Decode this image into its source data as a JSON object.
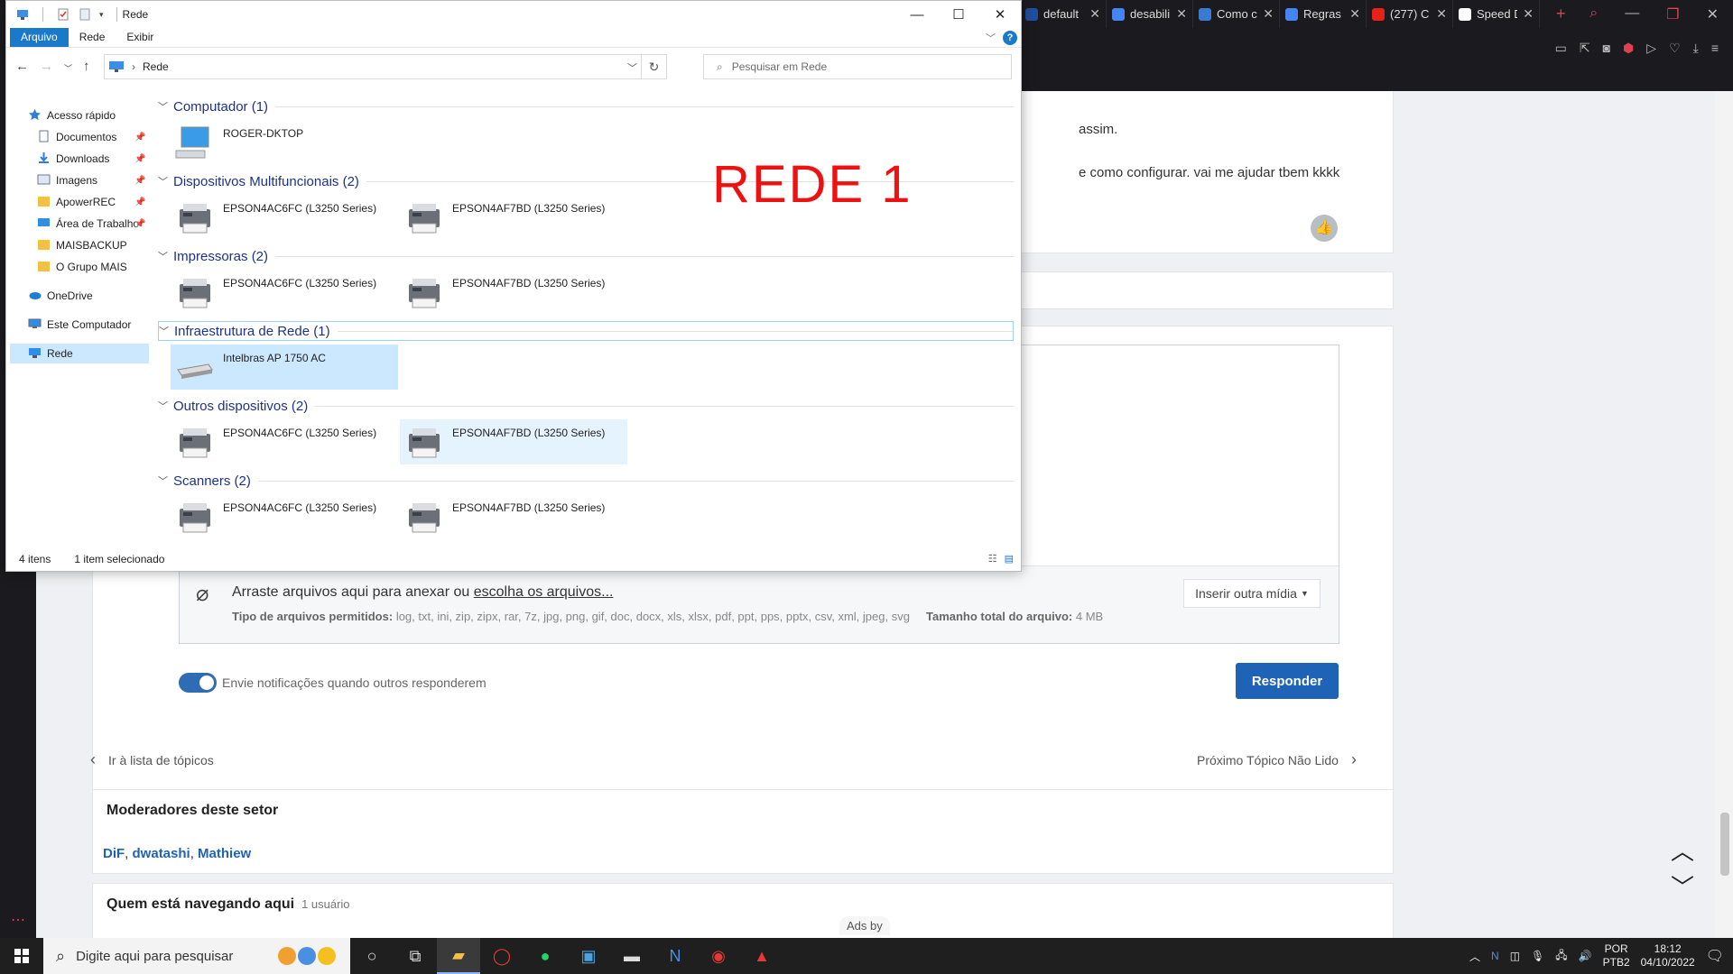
{
  "browser": {
    "tabs": [
      {
        "title": "default",
        "color": "#1f4fa0"
      },
      {
        "title": "desabili",
        "color": "#4285f4"
      },
      {
        "title": "Como c",
        "color": "#3b7ad1"
      },
      {
        "title": "Regras",
        "color": "#4285f4"
      },
      {
        "title": "(277) C",
        "color": "#e62117"
      },
      {
        "title": "Speed D",
        "color": "#ffffff"
      }
    ],
    "new_tab": "+"
  },
  "forum": {
    "post_line1": "assim.",
    "post_line2": "e como configurar. vai me ajudar tbem kkkk",
    "attach_text": "Arraste arquivos aqui para anexar ou ",
    "attach_link": "escolha os arquivos...",
    "types_label": "Tipo de arquivos permitidos:",
    "types_value": "log, txt, ini, zip, zipx, rar, 7z, jpg, png, gif, doc, docx, xls, xlsx, pdf, ppt, pps, pptx, csv, xml, jpeg, svg",
    "size_label": "Tamanho total do arquivo:",
    "size_value": "4 MB",
    "media_button": "Inserir outra mídia",
    "notify_label": "Envie notificações quando outros responderem",
    "reply_button": "Responder",
    "back_link": "Ir à lista de tópicos",
    "next_link": "Próximo Tópico Não Lido",
    "moderators_heading": "Moderadores deste setor",
    "moderators": [
      "DiF",
      "dwatashi",
      "Mathiew"
    ],
    "browsing_heading": "Quem está navegando aqui",
    "browsing_count": "1 usuário",
    "ads": "Ads by"
  },
  "explorer": {
    "title": "Rede",
    "ribbon_tabs": [
      "Arquivo",
      "Rede",
      "Exibir"
    ],
    "help": "?",
    "breadcrumb": "Rede",
    "search_placeholder": "Pesquisar em Rede",
    "nav": [
      {
        "label": "Acesso rápido",
        "icon": "star-icon",
        "pinned": false
      },
      {
        "label": "Documentos",
        "icon": "documents-icon",
        "pinned": true
      },
      {
        "label": "Downloads",
        "icon": "download-icon",
        "pinned": true
      },
      {
        "label": "Imagens",
        "icon": "pictures-icon",
        "pinned": true
      },
      {
        "label": "ApowerREC",
        "icon": "folder-icon",
        "pinned": true
      },
      {
        "label": "Área de Trabalho",
        "icon": "desktop-icon",
        "pinned": true
      },
      {
        "label": "MAISBACKUP",
        "icon": "folder-icon",
        "pinned": false
      },
      {
        "label": "O Grupo MAIS",
        "icon": "folder-icon",
        "pinned": false
      },
      {
        "label": "OneDrive",
        "icon": "cloud-icon",
        "pinned": false
      },
      {
        "label": "Este Computador",
        "icon": "computer-icon",
        "pinned": false
      },
      {
        "label": "Rede",
        "icon": "network-icon",
        "pinned": false
      }
    ],
    "groups": [
      {
        "title": "Computador (1)",
        "items": [
          "ROGER-DKTOP"
        ],
        "kind": "computer"
      },
      {
        "title": "Dispositivos Multifuncionais (2)",
        "items": [
          "EPSON4AC6FC (L3250 Series)",
          "EPSON4AF7BD (L3250 Series)"
        ],
        "kind": "printer"
      },
      {
        "title": "Impressoras (2)",
        "items": [
          "EPSON4AC6FC (L3250 Series)",
          "EPSON4AF7BD (L3250 Series)"
        ],
        "kind": "printer"
      },
      {
        "title": "Infraestrutura de Rede (1)",
        "items": [
          "Intelbras AP 1750 AC"
        ],
        "kind": "router"
      },
      {
        "title": "Outros dispositivos (2)",
        "items": [
          "EPSON4AC6FC (L3250 Series)",
          "EPSON4AF7BD (L3250 Series)"
        ],
        "kind": "printer"
      },
      {
        "title": "Scanners (2)",
        "items": [
          "EPSON4AC6FC (L3250 Series)",
          "EPSON4AF7BD (L3250 Series)"
        ],
        "kind": "printer"
      }
    ],
    "status_items": "4 itens",
    "status_selected": "1 item selecionado",
    "annotation": "REDE  1"
  },
  "taskbar": {
    "search_placeholder": "Digite aqui para pesquisar",
    "lang_top": "POR",
    "lang_bottom": "PTB2",
    "time": "18:12",
    "date": "04/10/2022"
  }
}
